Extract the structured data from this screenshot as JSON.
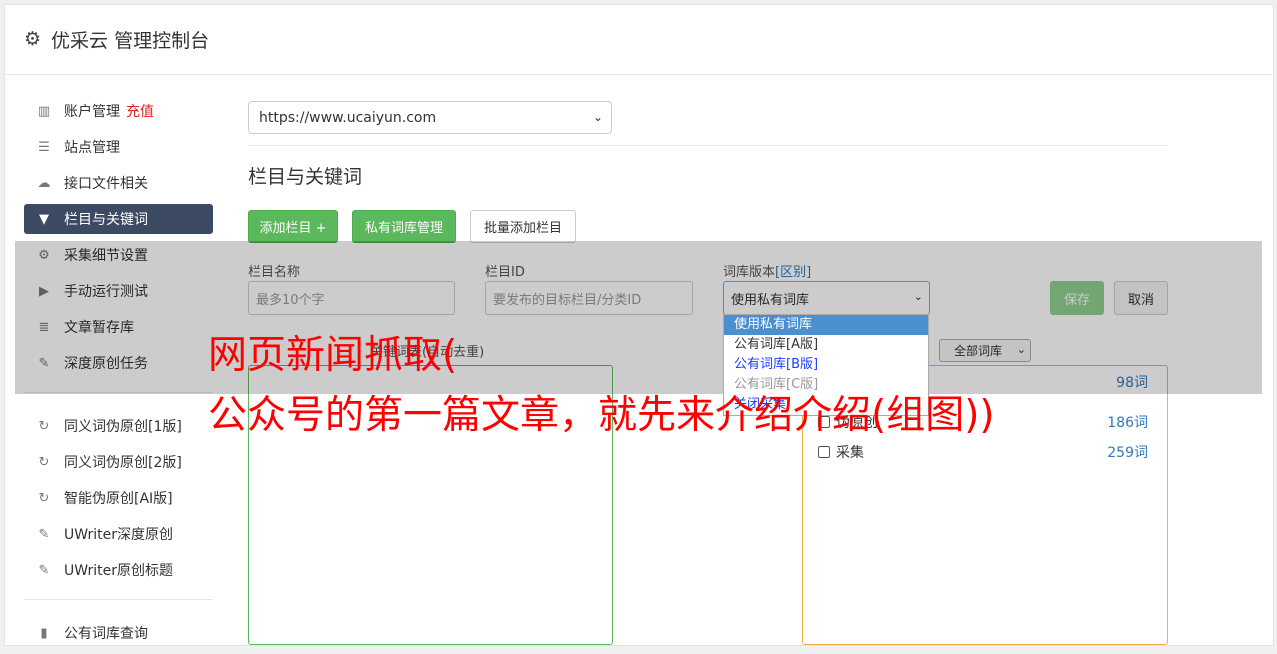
{
  "app": {
    "title": "优采云 管理控制台",
    "icon": "gear-icon"
  },
  "sidebar": {
    "group1": [
      {
        "label": "账户管理",
        "badge": "充值",
        "icon": "bar-chart-icon",
        "active": false
      },
      {
        "label": "站点管理",
        "icon": "server-icon",
        "active": false
      },
      {
        "label": "接口文件相关",
        "icon": "cloud-upload-icon",
        "active": false
      },
      {
        "label": "栏目与关键词",
        "icon": "filter-icon",
        "active": true
      },
      {
        "label": "采集细节设置",
        "icon": "cogs-icon",
        "active": false
      },
      {
        "label": "手动运行测试",
        "icon": "play-circle-icon",
        "active": false
      },
      {
        "label": "文章暂存库",
        "icon": "database-icon",
        "active": false
      },
      {
        "label": "深度原创任务",
        "icon": "edit-icon",
        "active": false
      }
    ],
    "group2": [
      {
        "label": "同义词伪原创[1版]",
        "icon": "refresh-icon"
      },
      {
        "label": "同义词伪原创[2版]",
        "icon": "refresh-icon"
      },
      {
        "label": "智能伪原创[AI版]",
        "icon": "refresh-icon"
      },
      {
        "label": "UWriter深度原创",
        "icon": "edit-icon"
      },
      {
        "label": "UWriter原创标题",
        "icon": "edit-icon"
      }
    ],
    "group3": [
      {
        "label": "公有词库查询",
        "icon": "book-icon"
      }
    ]
  },
  "site_select": {
    "value": "https://www.ucaiyun.com"
  },
  "section_title": "栏目与关键词",
  "toolbar": {
    "add_column": "添加栏目 +",
    "private_lib": "私有词库管理",
    "batch_add": "批量添加栏目"
  },
  "form": {
    "name_label": "栏目名称",
    "name_placeholder": "最多10个字",
    "id_label": "栏目ID",
    "id_placeholder": "要发布的目标栏目/分类ID",
    "lib_label": "词库版本",
    "lib_label_link": "[区别]",
    "lib_value": "使用私有词库",
    "save": "保存",
    "cancel": "取消"
  },
  "lib_dropdown": {
    "options": [
      "使用私有词库",
      "公有词库[A版]",
      "公有词库[B版]",
      "公有词库[C版]",
      "关闭采集"
    ]
  },
  "keywords": {
    "label": "关键词表(自动去重)",
    "filter_value": "全部词库"
  },
  "lib_list": [
    {
      "label": "",
      "count": "98词"
    },
    {
      "label": "伪原创",
      "count": "186词"
    },
    {
      "label": "采集",
      "count": "259词"
    }
  ],
  "watermark": {
    "line1": "网页新闻抓取(",
    "line2": "公众号的第一篇文章，就先来介绍介绍(组图))"
  },
  "colors": {
    "green": "#5cb85c",
    "active_nav": "#3d4a63",
    "watermark": "#ff0000",
    "link": "#337ab7"
  }
}
